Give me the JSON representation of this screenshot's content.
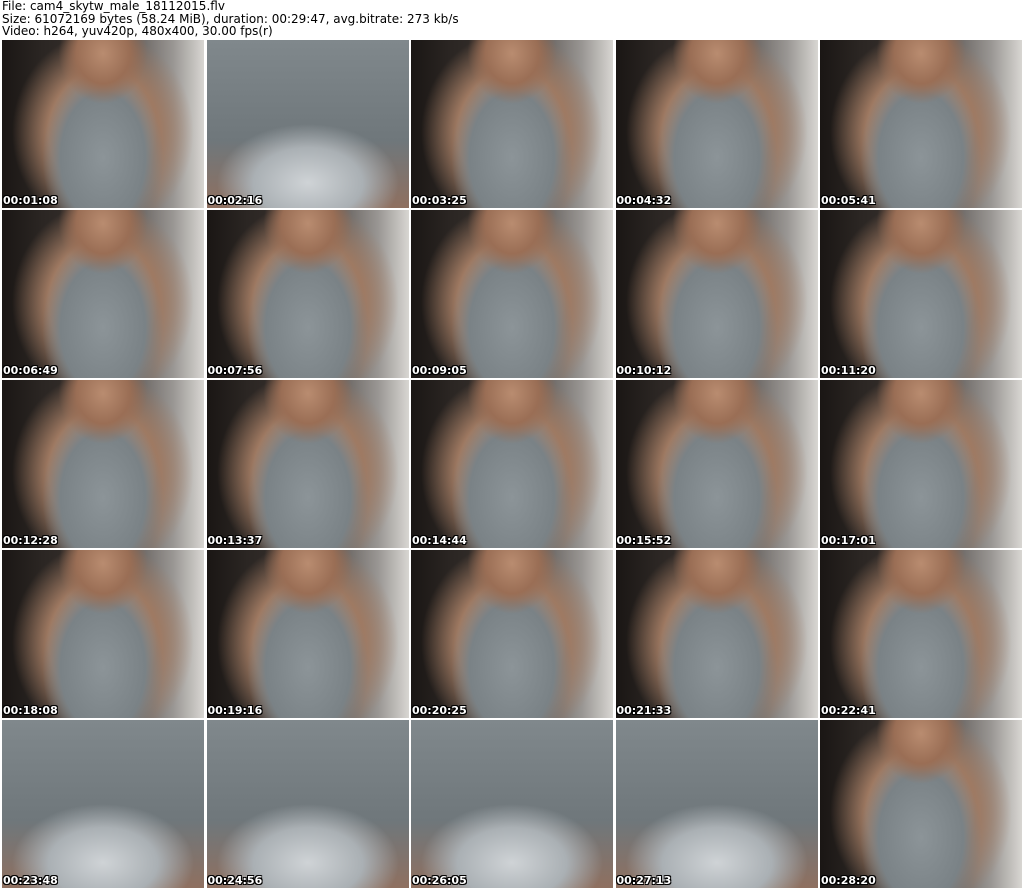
{
  "header": {
    "file_line": "File: cam4_skytw_male_18112015.flv",
    "size_line": "Size: 61072169 bytes (58.24 MiB), duration: 00:29:47, avg.bitrate: 273 kb/s",
    "video_line": "Video: h264, yuv420p, 480x400, 30.00 fps(r)"
  },
  "thumbnails": [
    {
      "time": "00:01:08",
      "style": "wide"
    },
    {
      "time": "00:02:16",
      "style": "close"
    },
    {
      "time": "00:03:25",
      "style": "wide"
    },
    {
      "time": "00:04:32",
      "style": "wide"
    },
    {
      "time": "00:05:41",
      "style": "wide"
    },
    {
      "time": "00:06:49",
      "style": "wide"
    },
    {
      "time": "00:07:56",
      "style": "wide"
    },
    {
      "time": "00:09:05",
      "style": "wide"
    },
    {
      "time": "00:10:12",
      "style": "wide"
    },
    {
      "time": "00:11:20",
      "style": "wide"
    },
    {
      "time": "00:12:28",
      "style": "wide"
    },
    {
      "time": "00:13:37",
      "style": "wide"
    },
    {
      "time": "00:14:44",
      "style": "wide"
    },
    {
      "time": "00:15:52",
      "style": "wide"
    },
    {
      "time": "00:17:01",
      "style": "wide"
    },
    {
      "time": "00:18:08",
      "style": "wide"
    },
    {
      "time": "00:19:16",
      "style": "wide"
    },
    {
      "time": "00:20:25",
      "style": "wide"
    },
    {
      "time": "00:21:33",
      "style": "wide"
    },
    {
      "time": "00:22:41",
      "style": "wide"
    },
    {
      "time": "00:23:48",
      "style": "close"
    },
    {
      "time": "00:24:56",
      "style": "close"
    },
    {
      "time": "00:26:05",
      "style": "close"
    },
    {
      "time": "00:27:13",
      "style": "close"
    },
    {
      "time": "00:28:20",
      "style": "wide"
    }
  ]
}
